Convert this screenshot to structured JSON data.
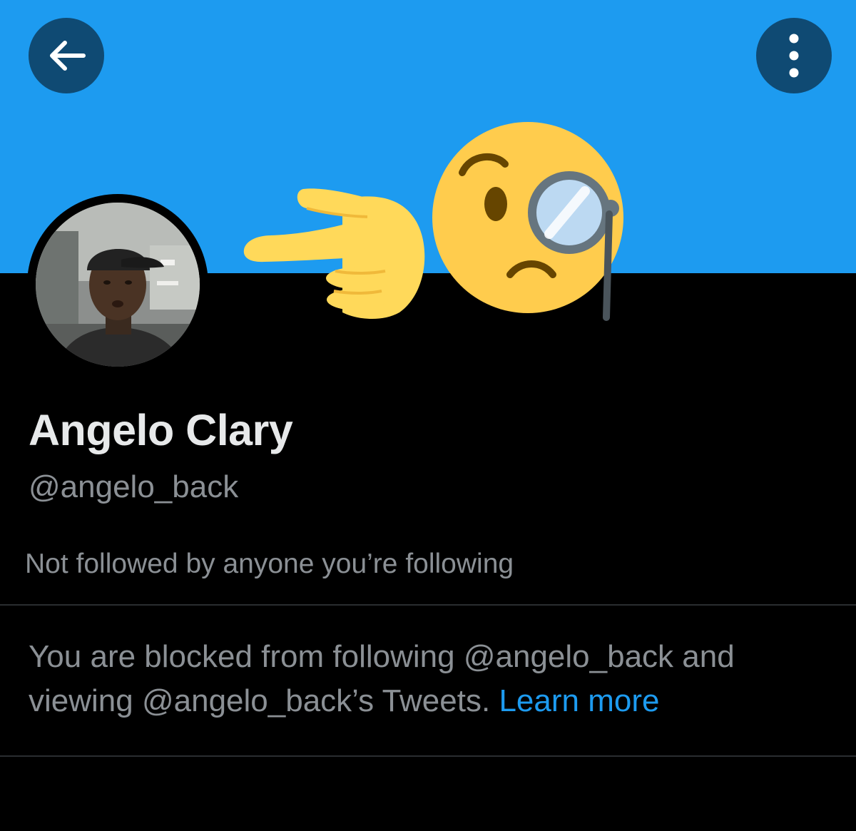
{
  "header": {
    "back_icon": "arrow-left-icon",
    "more_icon": "vertical-ellipsis-icon",
    "banner_color": "#1d9bf0",
    "button_color": "#0f4a73"
  },
  "banner_art": {
    "emojis": [
      "backhand-index-pointing-right-emoji",
      "face-with-monocle-emoji"
    ]
  },
  "profile": {
    "display_name": "Angelo Clary",
    "handle": "@angelo_back",
    "followers_note": "Not followed by anyone you’re following"
  },
  "blocked_notice": {
    "line_1": "You are blocked from following @angelo_back and",
    "line_2": "viewing @angelo_back’s Tweets.",
    "link_label": "Learn more",
    "link_color": "#1d9bf0"
  }
}
